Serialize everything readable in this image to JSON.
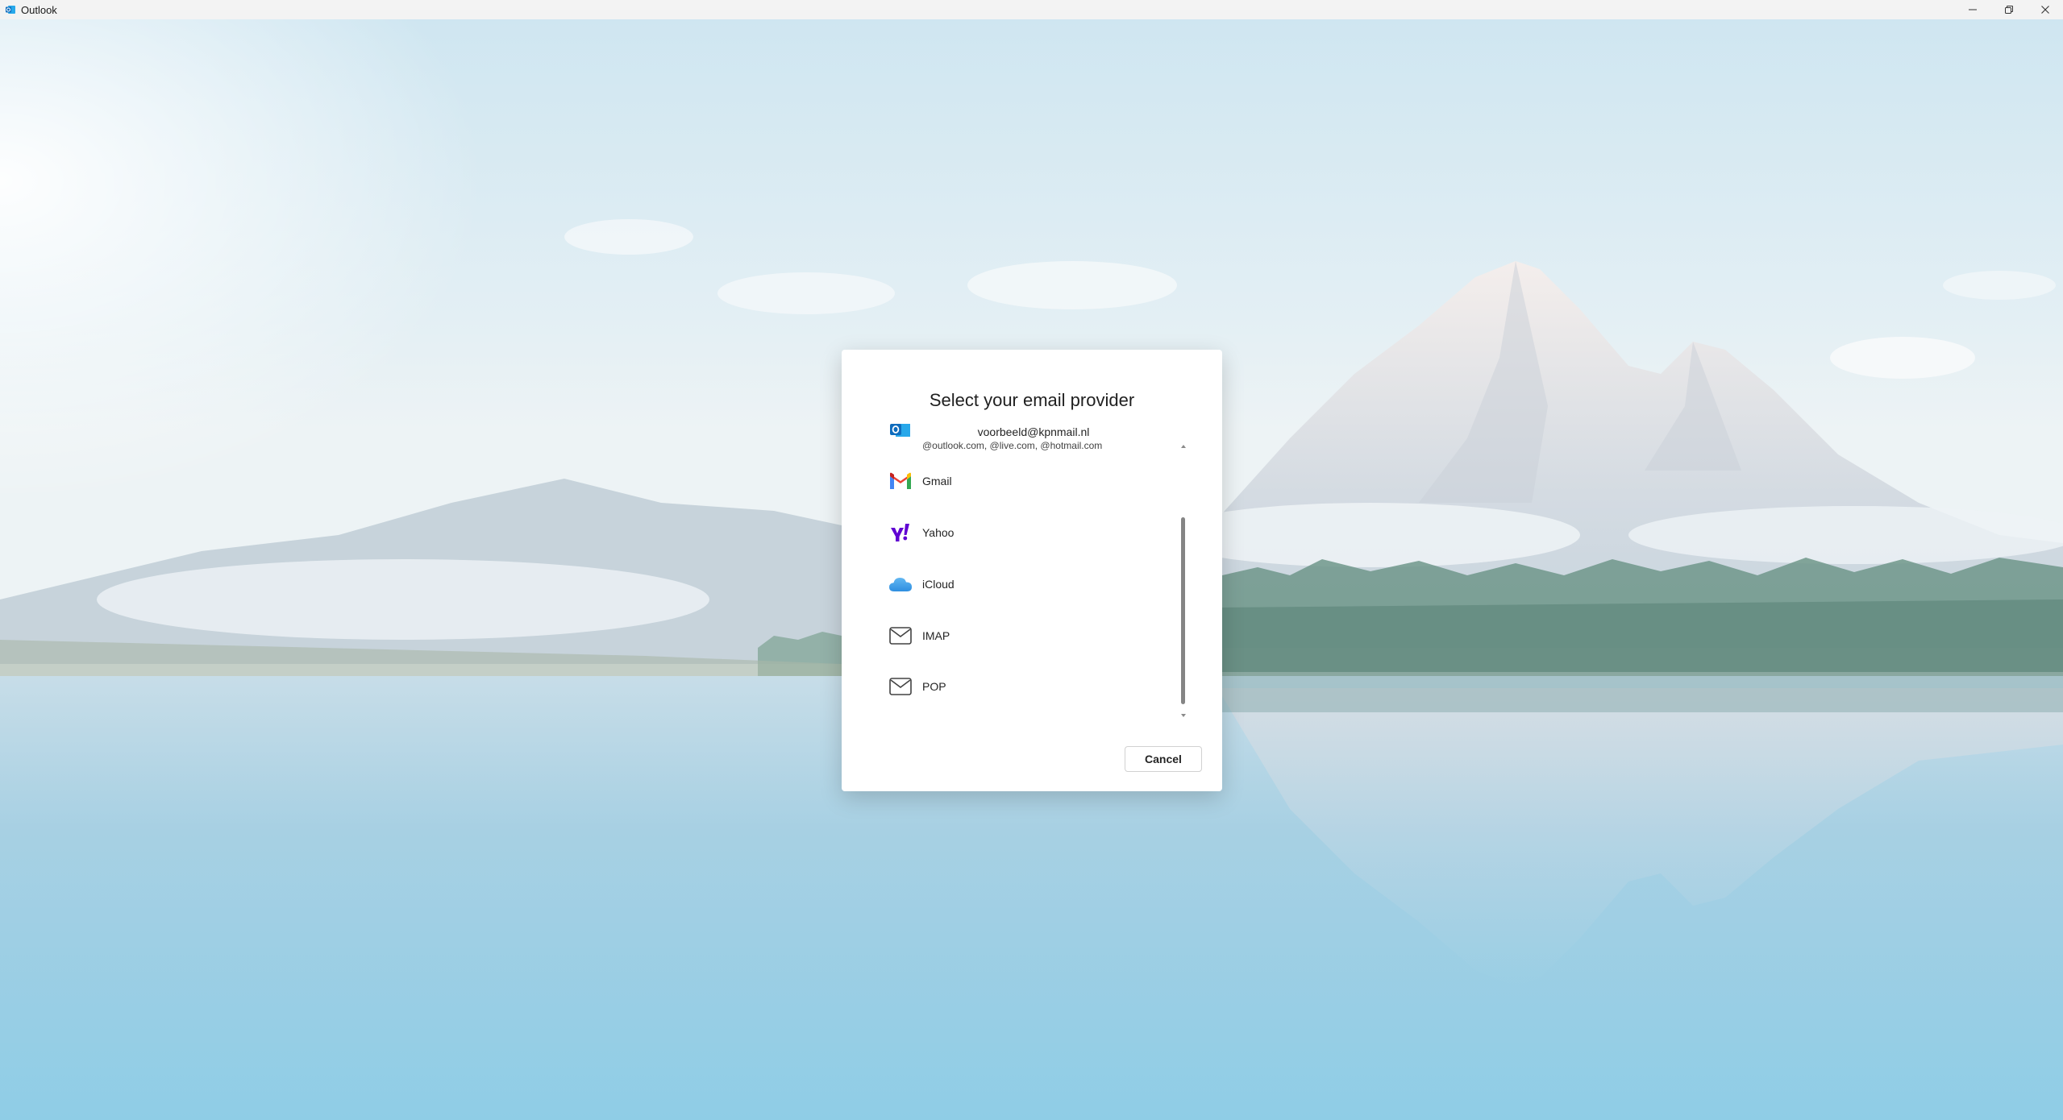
{
  "window": {
    "title": "Outlook",
    "controls": {
      "minimize_icon": "minimize-icon",
      "restore_icon": "restore-icon",
      "close_icon": "close-icon"
    }
  },
  "dialog": {
    "title": "Select your email provider",
    "providers": {
      "outlook": {
        "email": "voorbeeld@kpnmail.nl",
        "domains": "@outlook.com, @live.com, @hotmail.com",
        "icon": "outlook-icon"
      },
      "gmail": {
        "label": "Gmail",
        "icon": "gmail-icon"
      },
      "yahoo": {
        "label": "Yahoo",
        "icon": "yahoo-icon"
      },
      "icloud": {
        "label": "iCloud",
        "icon": "icloud-icon"
      },
      "imap": {
        "label": "IMAP",
        "icon": "mail-icon"
      },
      "pop": {
        "label": "POP",
        "icon": "mail-icon"
      }
    },
    "cancel_label": "Cancel"
  },
  "colors": {
    "outlook_blue": "#0f6cbd",
    "yahoo_purple": "#6001d2",
    "icloud_blue": "#3b9fe8"
  }
}
